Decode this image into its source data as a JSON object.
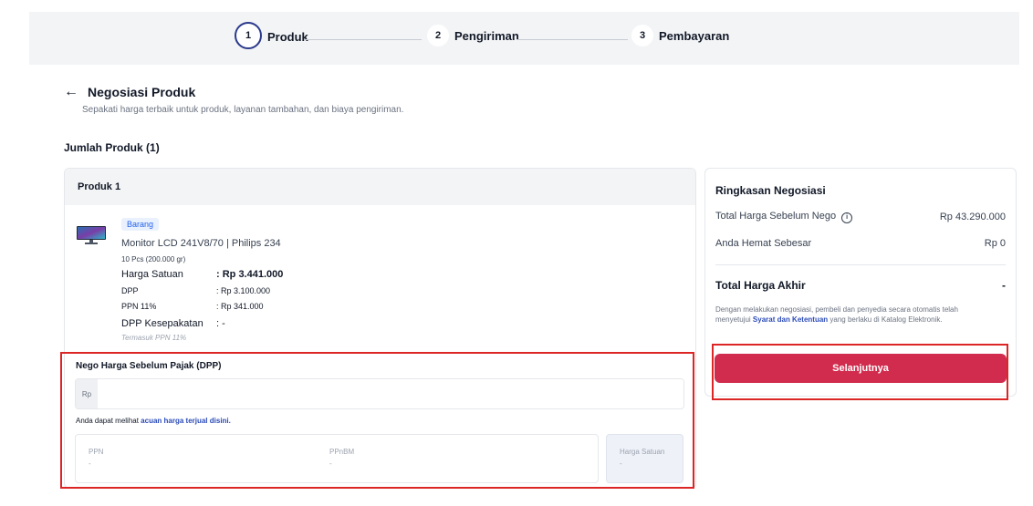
{
  "stepper": {
    "steps": [
      {
        "num": "1",
        "label": "Produk"
      },
      {
        "num": "2",
        "label": "Pengiriman"
      },
      {
        "num": "3",
        "label": "Pembayaran"
      }
    ]
  },
  "header": {
    "title": "Negosiasi Produk",
    "subtitle": "Sepakati harga terbaik untuk produk, layanan tambahan, dan biaya pengiriman."
  },
  "products": {
    "count_label": "Jumlah Produk (1)",
    "card_title": "Produk 1",
    "badge": "Barang",
    "name": "Monitor LCD 241V8/70 | Philips 234",
    "qty": "10 Pcs (200.000 gr)",
    "harga_satuan_label": "Harga Satuan",
    "harga_satuan_value": ": Rp 3.441.000",
    "dpp_label": "DPP",
    "dpp_value": ": Rp 3.100.000",
    "ppn_label": "PPN 11%",
    "ppn_value": ": Rp 341.000",
    "dpp_kesepakatan_label": "DPP Kesepakatan",
    "dpp_kesepakatan_value": ": -",
    "included_note": "Termasuk PPN 11%"
  },
  "nego": {
    "title": "Nego Harga Sebelum Pajak (DPP)",
    "prefix": "Rp",
    "input_value": "",
    "hint_text": "Anda dapat melihat ",
    "hint_link": "acuan harga terjual disini.",
    "ppn_label": "PPN",
    "ppn_value": "-",
    "ppnbm_label": "PPnBM",
    "ppnbm_value": "-",
    "unit_label": "Harga Satuan",
    "unit_value": "-"
  },
  "summary": {
    "title": "Ringkasan Negosiasi",
    "before_label": "Total Harga Sebelum Nego",
    "before_value": "Rp 43.290.000",
    "saving_label": "Anda Hemat Sebesar",
    "saving_value": "Rp 0",
    "total_label": "Total Harga Akhir",
    "total_value": "-",
    "terms_pre": "Dengan melakukan negosiasi, pembeli dan penyedia secara otomatis telah menyetujui ",
    "terms_link": "Syarat dan Ketentuan",
    "terms_post": " yang berlaku di Katalog Elektronik.",
    "next_button": "Selanjutnya"
  },
  "colors": {
    "accent": "#2b3a8c",
    "primary_button": "#d12c4e",
    "highlight": "#dc2626"
  }
}
